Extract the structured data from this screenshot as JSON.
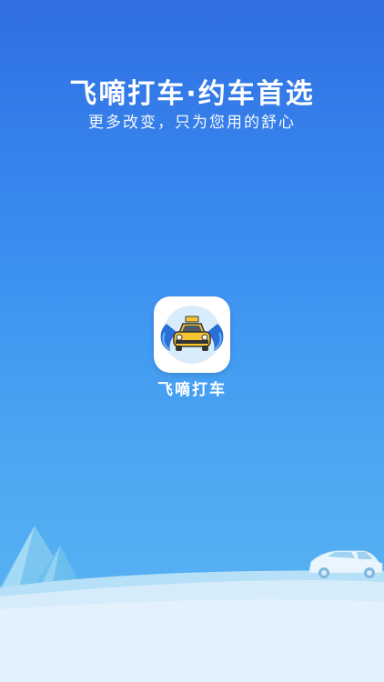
{
  "splash": {
    "headline": "飞嘀打车·约车首选",
    "subline": "更多改变，只为您用的舒心",
    "app_name": "飞嘀打车"
  },
  "colors": {
    "background_top": "#2f6ee3",
    "background_bottom": "#5fb7f2",
    "taxi_yellow": "#f7c531",
    "wing_blue": "#2a6fd6"
  },
  "icons": {
    "app_logo": "taxi-with-wings-icon",
    "scenery_mountains": "mountain-icon",
    "scenery_car": "car-icon"
  }
}
